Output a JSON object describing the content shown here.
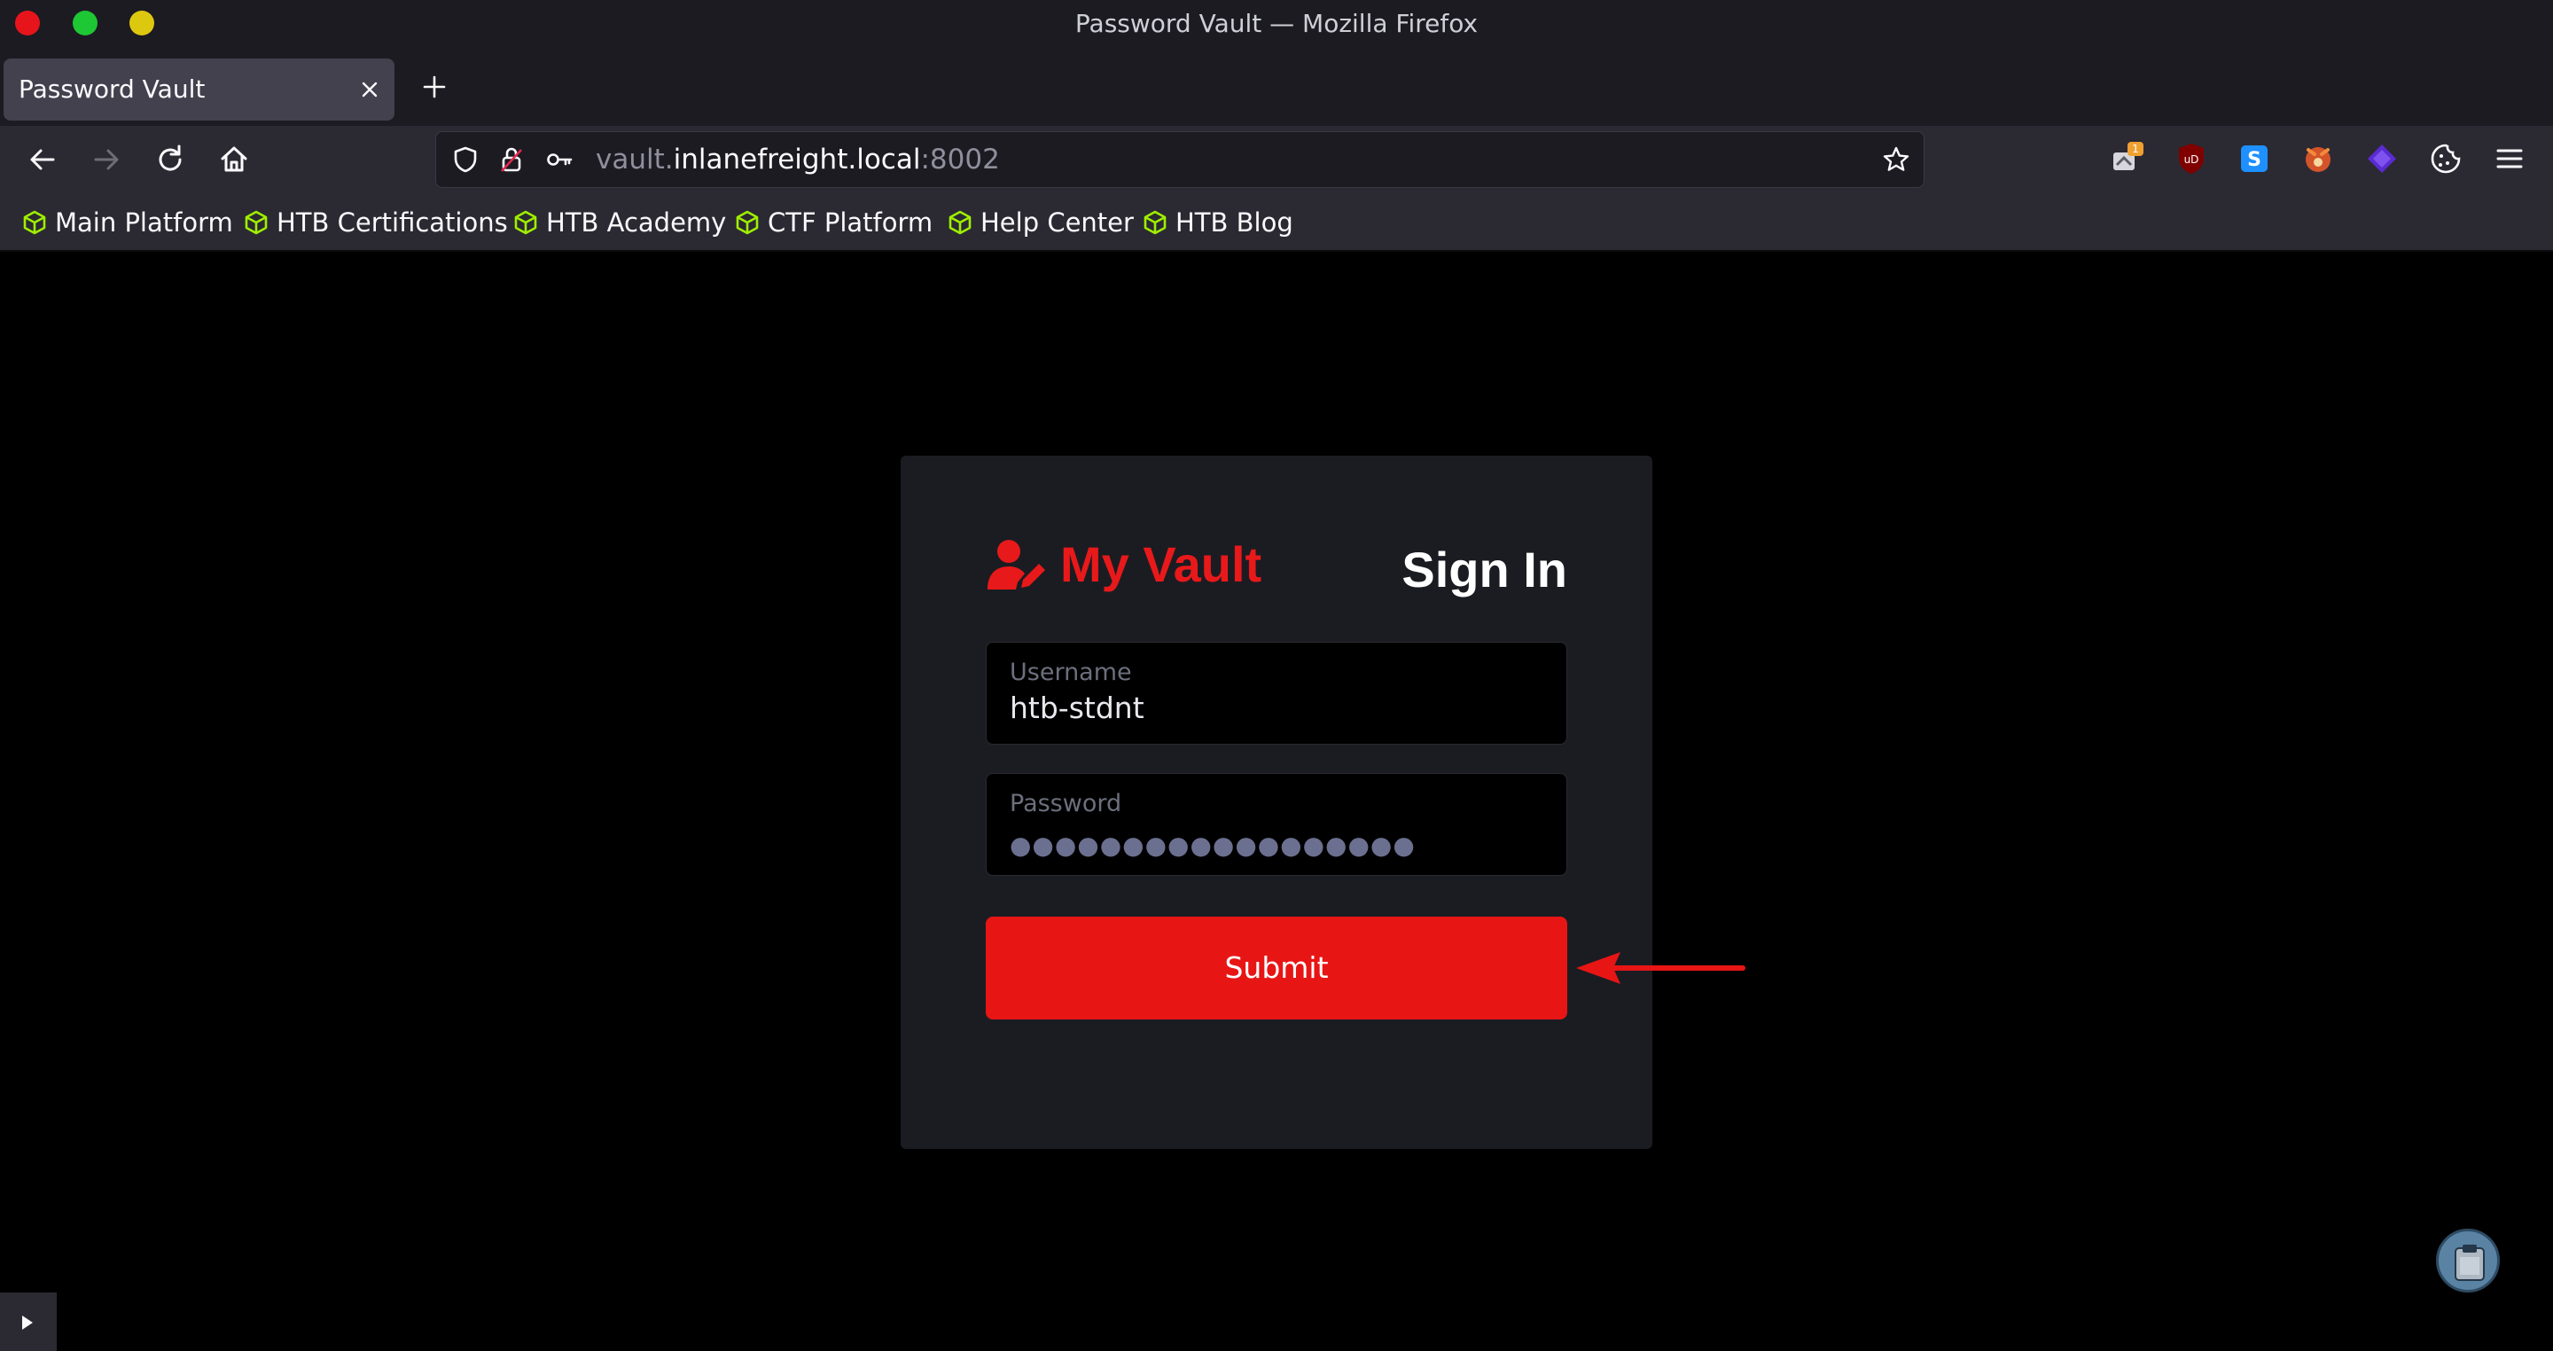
{
  "window": {
    "title": "Password Vault — Mozilla Firefox"
  },
  "tabs": [
    {
      "label": "Password Vault"
    }
  ],
  "urlbar": {
    "subdomain": "vault.",
    "host": "inlanefreight.local",
    "port": ":8002"
  },
  "bookmarks": [
    {
      "label": "Main Platform"
    },
    {
      "label": "HTB Certifications"
    },
    {
      "label": "HTB Academy"
    },
    {
      "label": "CTF Platform"
    },
    {
      "label": "Help Center"
    },
    {
      "label": "HTB Blog"
    }
  ],
  "login": {
    "brand": "My Vault",
    "heading": "Sign In",
    "username_label": "Username",
    "username_value": "htb-stdnt",
    "password_label": "Password",
    "password_mask": "●●●●●●●●●●●●●●●●●●",
    "submit_label": "Submit"
  },
  "colors": {
    "accent": "#e81515",
    "bookmark_icon": "#9fef00"
  }
}
